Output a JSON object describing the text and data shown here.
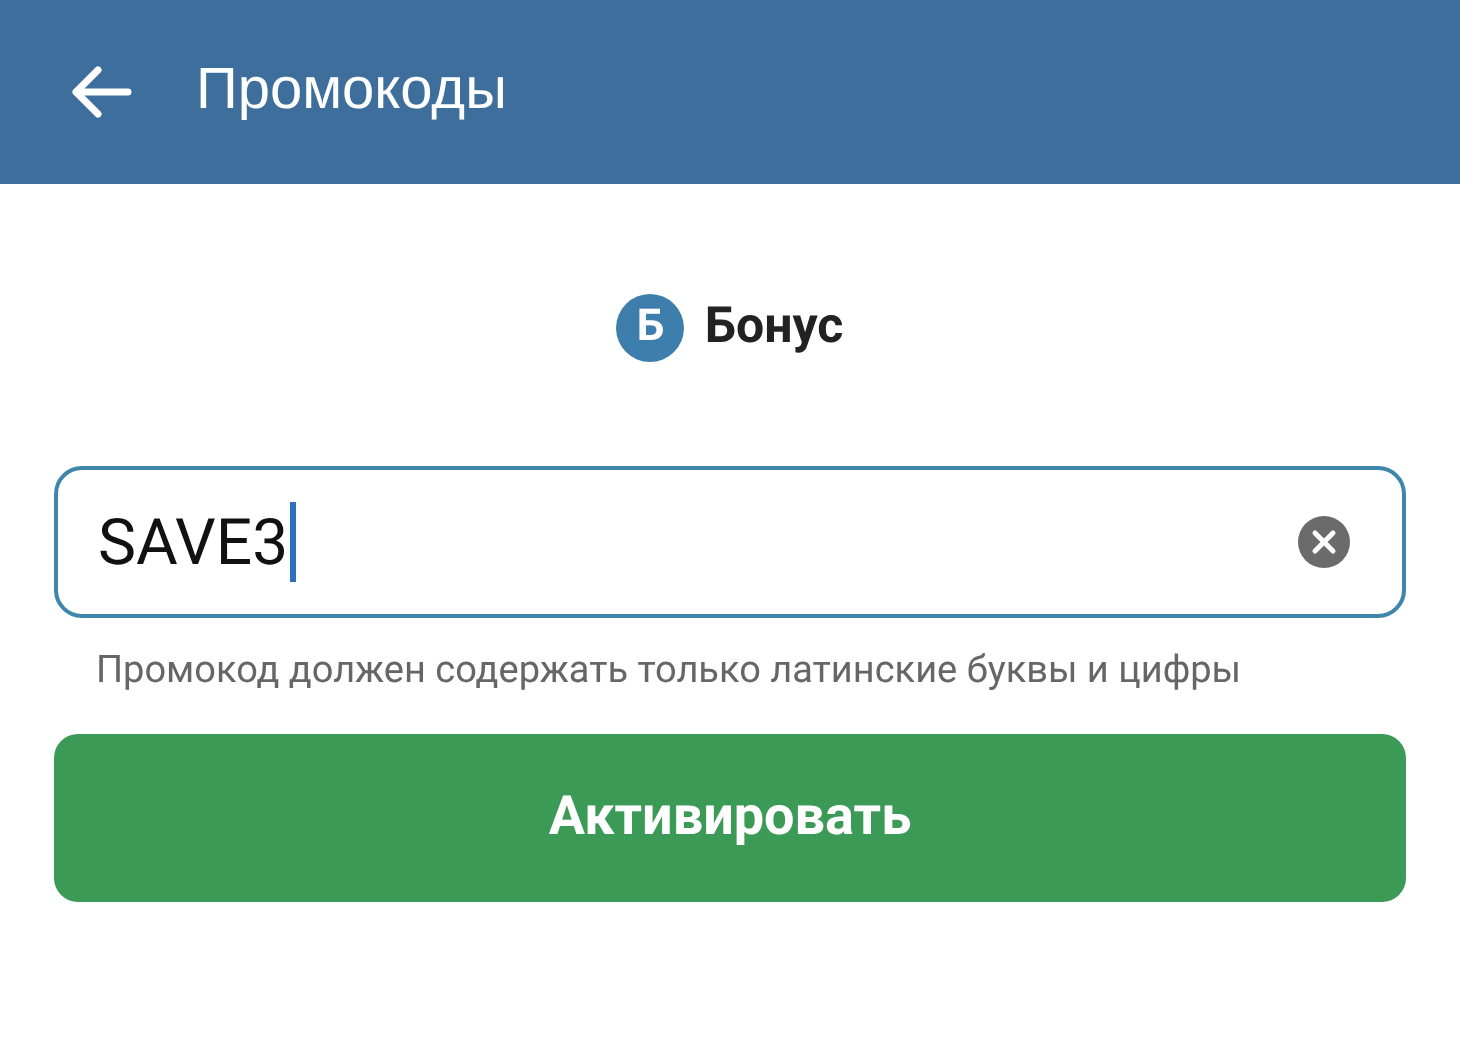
{
  "header": {
    "title": "Промокоды"
  },
  "brand": {
    "logo_letter": "Б",
    "name": "Бонус"
  },
  "promo_field": {
    "value": "SAVE3",
    "focused": true
  },
  "hint": "Промокод должен содержать только латинские буквы и цифры",
  "activate_button": {
    "label": "Активировать"
  }
}
